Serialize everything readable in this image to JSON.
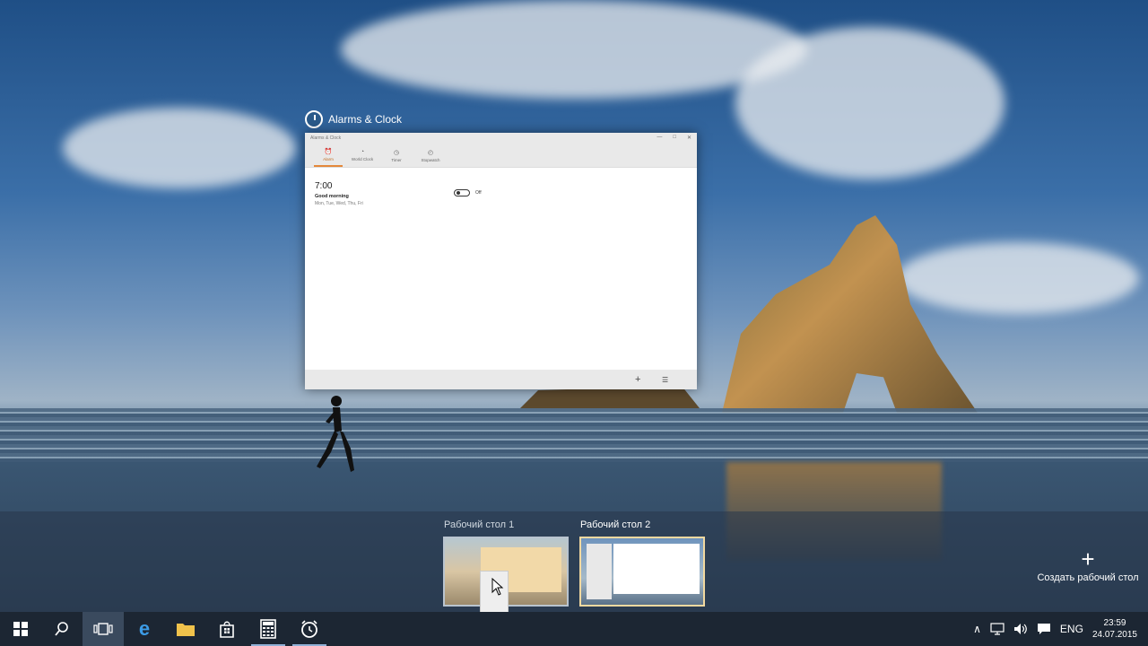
{
  "app_window": {
    "title": "Alarms & Clock",
    "titlebar_text": "Alarms & Clock",
    "controls": [
      "—",
      "□",
      "✕"
    ],
    "tabs": [
      {
        "label": "Alarm",
        "icon": "alarm-icon"
      },
      {
        "label": "World Clock",
        "icon": "world-clock-icon"
      },
      {
        "label": "Timer",
        "icon": "timer-icon"
      },
      {
        "label": "Stopwatch",
        "icon": "stopwatch-icon"
      }
    ],
    "alarm": {
      "time": "7:00",
      "name": "Good morning",
      "days": "Mon, Tue, Wed, Thu, Fri",
      "toggle_label": "Off"
    },
    "bottom": {
      "add": "+",
      "select": "☰"
    }
  },
  "desktops": [
    {
      "label": "Рабочий стол 1"
    },
    {
      "label": "Рабочий стол 2"
    }
  ],
  "new_desktop": {
    "plus": "+",
    "label": "Создать рабочий стол"
  },
  "taskbar": {
    "apps": [
      "start-icon",
      "search-icon",
      "task-view-icon",
      "edge-icon",
      "file-explorer-icon",
      "store-icon",
      "calculator-icon",
      "alarms-icon"
    ]
  },
  "tray": {
    "lang": "ENG",
    "time": "23:59",
    "date": "24.07.2015"
  },
  "colors": {
    "accent": "#e3883b",
    "taskbar": "#1c2633"
  }
}
